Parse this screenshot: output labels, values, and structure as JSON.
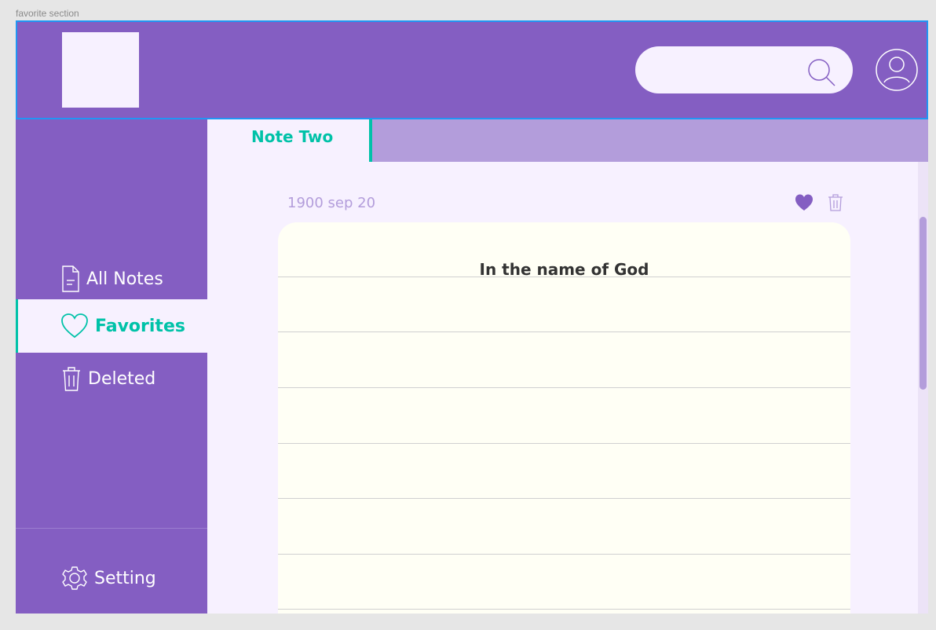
{
  "frame_label": "favorite section",
  "header": {
    "logo": "app-logo",
    "search_placeholder": "",
    "icons": {
      "search": "search-icon",
      "profile": "user-profile-icon"
    }
  },
  "sidebar": {
    "items": [
      {
        "label": "All Notes",
        "icon": "document-icon"
      },
      {
        "label": "Favorites",
        "icon": "heart-icon",
        "active": true
      },
      {
        "label": "Deleted",
        "icon": "trash-icon"
      }
    ],
    "settings_label": "Setting",
    "settings_icon": "gear-icon"
  },
  "tabs": [
    {
      "label": "Note Two",
      "active": true
    }
  ],
  "note": {
    "date": "1900 sep 20",
    "title": "In the name of God",
    "favorited": true
  },
  "colors": {
    "primary": "#845ec2",
    "accent": "#00c2a8",
    "surface": "#f7f1ff",
    "tab_bar": "#b39ddb",
    "note_paper": "#fffff5"
  }
}
